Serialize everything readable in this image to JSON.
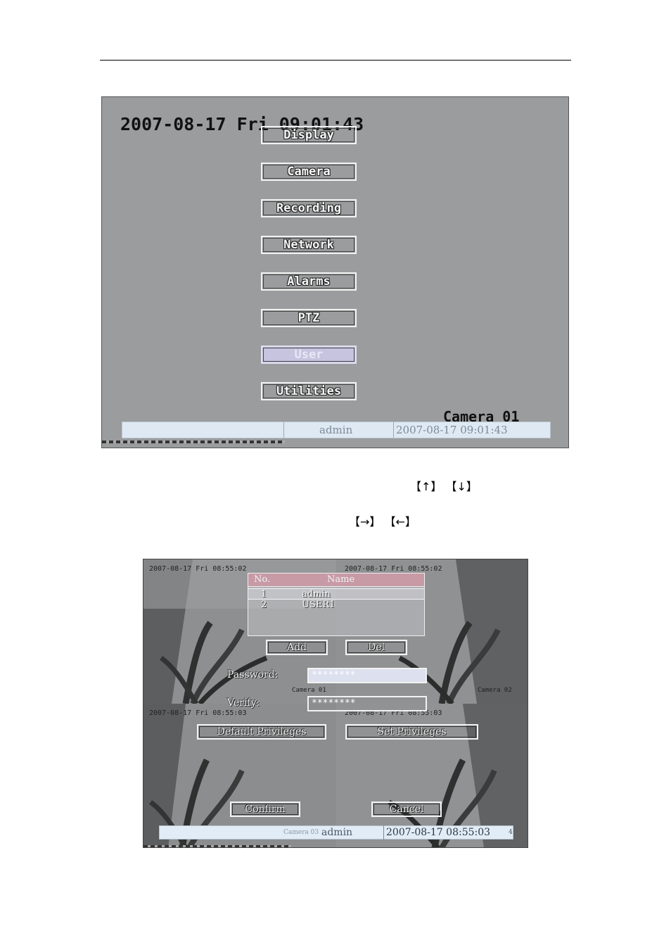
{
  "screen1": {
    "osd_datetime": "2007-08-17 Fri 09:01:43",
    "menu_items": [
      {
        "label": "Display",
        "selected": false
      },
      {
        "label": "Camera",
        "selected": false
      },
      {
        "label": "Recording",
        "selected": false
      },
      {
        "label": "Network",
        "selected": false
      },
      {
        "label": "Alarms",
        "selected": false
      },
      {
        "label": "PTZ",
        "selected": false
      },
      {
        "label": "User",
        "selected": true
      },
      {
        "label": "Utilities",
        "selected": false
      }
    ],
    "camera_label": "Camera 01",
    "status_bar": {
      "user": "admin",
      "datetime": "2007-08-17 09:01:43"
    }
  },
  "instructions": {
    "line1_keys": "【↑】 【↓】",
    "line2_keys": "【→】 【←】"
  },
  "screen2": {
    "quad_labels": {
      "q1_time": "2007-08-17 Fri 08:55:02",
      "q2_time": "2007-08-17 Fri 08:55:02",
      "q3_time": "2007-08-17 Fri 08:55:03",
      "q4_time": "2007-08-17 Fri 08:55:03",
      "q1_cam": "Camera 01",
      "q2_cam": "Camera 02"
    },
    "user_table": {
      "headers": {
        "no": "No.",
        "name": "Name"
      },
      "rows": [
        {
          "no": "1",
          "name": "admin",
          "selected": true
        },
        {
          "no": "2",
          "name": "USER1",
          "selected": false
        }
      ]
    },
    "buttons": {
      "add": "Add",
      "del": "Del",
      "default_privileges": "Default Privileges",
      "set_privileges": "Set Privileges",
      "confirm": "Confirm",
      "cancel": "Cancel"
    },
    "fields": {
      "password_label": "Password:",
      "password_value": "********",
      "verify_label": "Verify:",
      "verify_value": "********"
    },
    "status_bar": {
      "camera_ghost": "Camera 03",
      "user": "admin",
      "datetime": "2007-08-17 08:55:03",
      "suffix": "4"
    },
    "colors": {
      "table_header": "#c79aa6",
      "active_field": "#dde0ee",
      "status_bar": "#e2ecf6"
    }
  }
}
